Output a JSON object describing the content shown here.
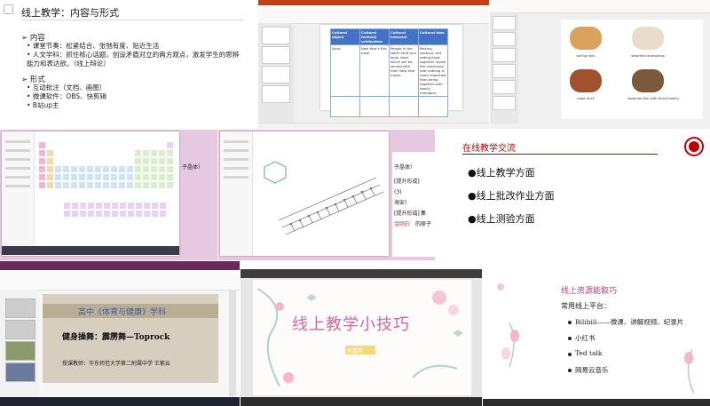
{
  "tile1": {
    "title": "线上教学：内容与形式",
    "section1": "➢ 内容",
    "bullets1": [
      "• 课堂节奏：松紧结合、张弛有度、贴近生活",
      "• 人文学科：抓住核心话题，创设矛盾对立的两方观点，激发学生的思辨",
      "  能力和表达欲。（线上辩论）"
    ],
    "section2": "➢ 形式",
    "bullets2": [
      "• 互动批注（文档、画图）",
      "• 微课软件：OBS、快剪辑",
      "• B站up主"
    ]
  },
  "tile2": {
    "headers": [
      "Cultural object",
      "Cultural festival/ celebration",
      "Cultural behavior",
      "Cultural idea"
    ],
    "row1": [
      "jiaozi",
      "New Year's Eve meal",
      "People in the North stuff and wrap jiaozi which will be served with their New Year meals.",
      "Making, cooking, and eating jiaozi together reveal the consensus that nothing is more important than being together with family members."
    ]
  },
  "tile3": {
    "captions": [
      "spring rolls",
      "steamed dumplings",
      "roast duck",
      "steamed fish with black beans"
    ]
  },
  "tile4": {
    "label_right": "子晶体）"
  },
  "tile5": {
    "doc_lines": [
      "子晶体）",
      "[提升形成]",
      "(3)",
      "海安）",
      "[提升形成]",
      "金刚石",
      "，集",
      "的原子"
    ]
  },
  "tile6": {
    "title": "在线教学交流",
    "items": [
      "●线上教学方面",
      "●线上批改作业方面",
      "●线上测验方面"
    ]
  },
  "tile7": {
    "course": "高中《体育与健康》学科",
    "lesson": "健身操舞：霹雳舞—Toprock",
    "teacher": "授课教师：华东师范大学第二附属中学  王紫云"
  },
  "tile8": {
    "title": "线上教学小技巧",
    "presenter": "张嘉尊"
  },
  "tile9": {
    "title": "线上资源能取巧",
    "subtitle": "常用线上平台：",
    "items": [
      "Bilibili——微课、讲解视频、纪录片",
      "小红书",
      "Ted talk",
      "网易云音乐"
    ]
  },
  "colors": {
    "pink_title": "#d9669a",
    "red_title": "#c00000",
    "ppt_table_header": "#4472c4"
  }
}
